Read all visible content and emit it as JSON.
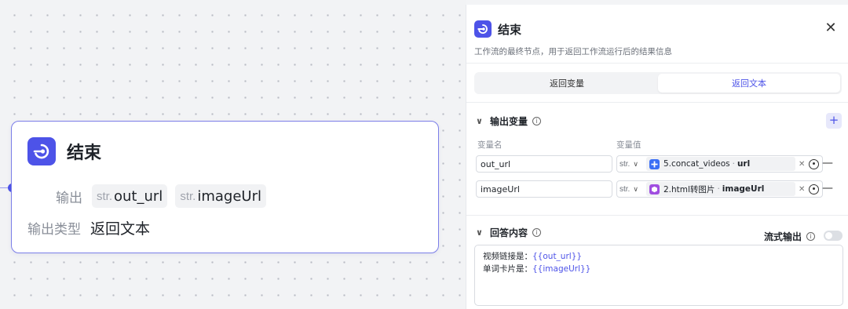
{
  "node": {
    "title": "结束",
    "output_label": "输出",
    "outputs": [
      {
        "type": "str.",
        "name": "out_url"
      },
      {
        "type": "str.",
        "name": "imageUrl"
      }
    ],
    "output_type_label": "输出类型",
    "output_type_value": "返回文本"
  },
  "panel": {
    "title": "结束",
    "description": "工作流的最终节点，用于返回工作流运行后的结果信息",
    "tabs": [
      "返回变量",
      "返回文本"
    ],
    "active_tab": "返回文本",
    "output_section": {
      "title": "输出变量",
      "col_name": "变量名",
      "col_value": "变量值",
      "rows": [
        {
          "name": "out_url",
          "type": "str.",
          "source": "5.concat_videos",
          "field": "url",
          "source_color": "#3b6ff5"
        },
        {
          "name": "imageUrl",
          "type": "str.",
          "source": "2.html转图片",
          "field": "imageUrl",
          "source_color": "#a04ee0"
        }
      ]
    },
    "answer_section": {
      "title": "回答内容",
      "stream_label": "流式输出",
      "stream_enabled": false,
      "lines": [
        {
          "prefix": "视频链接是：",
          "ref": "{{out_url}}"
        },
        {
          "prefix": "单词卡片是：",
          "ref": "{{imageUrl}}"
        }
      ]
    }
  },
  "colors": {
    "accent": "#4d53e8"
  }
}
